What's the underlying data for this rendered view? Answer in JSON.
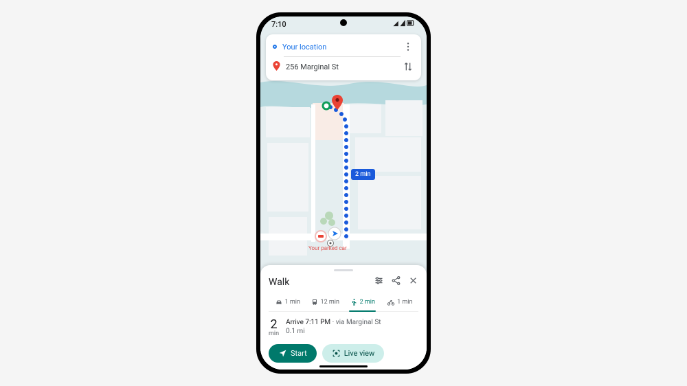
{
  "status": {
    "time": "7:10"
  },
  "search": {
    "origin": "Your location",
    "destination": "256 Marginal St"
  },
  "route_chip": "2 min",
  "parked_car_label": "Your parked\ncar",
  "sheet": {
    "title": "Walk",
    "tabs": {
      "drive": "1 min",
      "transit": "12 min",
      "walk": "2 min",
      "bike": "1 min"
    },
    "time_value": "2",
    "time_unit": "min",
    "arrive_label": "Arrive 7:11 PM",
    "via_label": " · via Marginal St",
    "distance": "0.1 mi",
    "start_label": "Start",
    "liveview_label": "Live view"
  }
}
